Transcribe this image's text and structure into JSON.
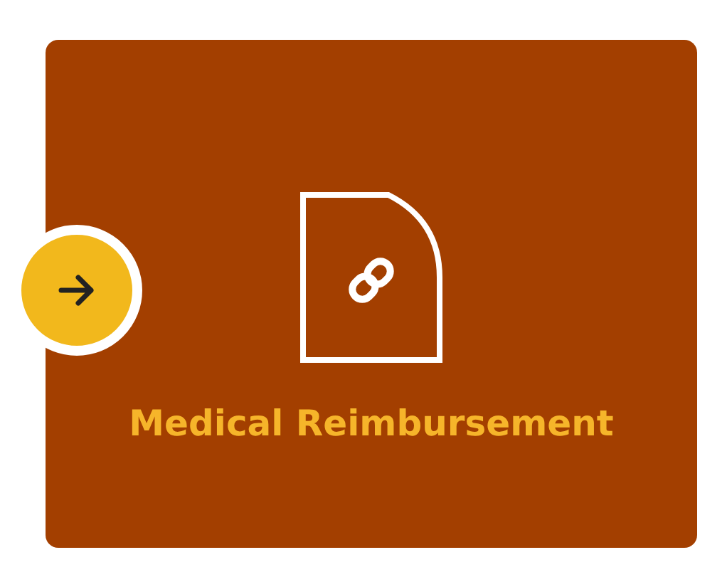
{
  "tile": {
    "title": "Medical Reimbursement"
  }
}
